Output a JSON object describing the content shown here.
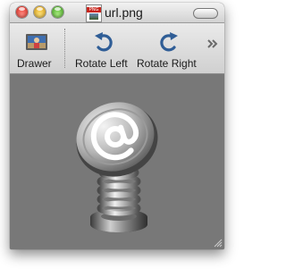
{
  "window": {
    "title": "url.png"
  },
  "proxy_icon": {
    "badge_text": "PNG"
  },
  "toolbar": {
    "items": [
      {
        "label": "Drawer",
        "icon": "drawer-icon"
      },
      {
        "label": "Rotate Left",
        "icon": "rotate-left-icon"
      },
      {
        "label": "Rotate Right",
        "icon": "rotate-right-icon"
      }
    ],
    "overflow_icon": "chevron-double-right-icon"
  },
  "image": {
    "subject": "at-sign-spring-icon"
  },
  "colors": {
    "content_background": "#787878",
    "rotate_icon_blue": "#2f5d96",
    "close": "#d8241b",
    "minimize": "#d99a08",
    "zoom": "#3c9e1b"
  }
}
